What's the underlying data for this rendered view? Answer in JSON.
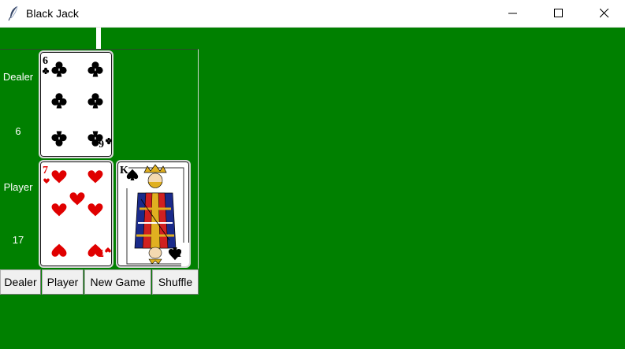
{
  "window": {
    "title": "Black Jack",
    "app_icon": "feather-icon",
    "controls": [
      "minimize-icon",
      "maximize-icon",
      "close-icon"
    ]
  },
  "table_color": "#008000",
  "dealer": {
    "label": "Dealer",
    "score": "6",
    "cards": [
      {
        "rank": "6",
        "suit": "clubs",
        "color": "#000000"
      }
    ]
  },
  "player": {
    "label": "Player",
    "score": "17",
    "cards": [
      {
        "rank": "7",
        "suit": "hearts",
        "color": "#e00000"
      },
      {
        "rank": "K",
        "suit": "spades",
        "color": "#000000"
      }
    ]
  },
  "buttons": {
    "dealer": "Dealer",
    "player": "Player",
    "new_game": "New Game",
    "shuffle": "Shuffle"
  }
}
